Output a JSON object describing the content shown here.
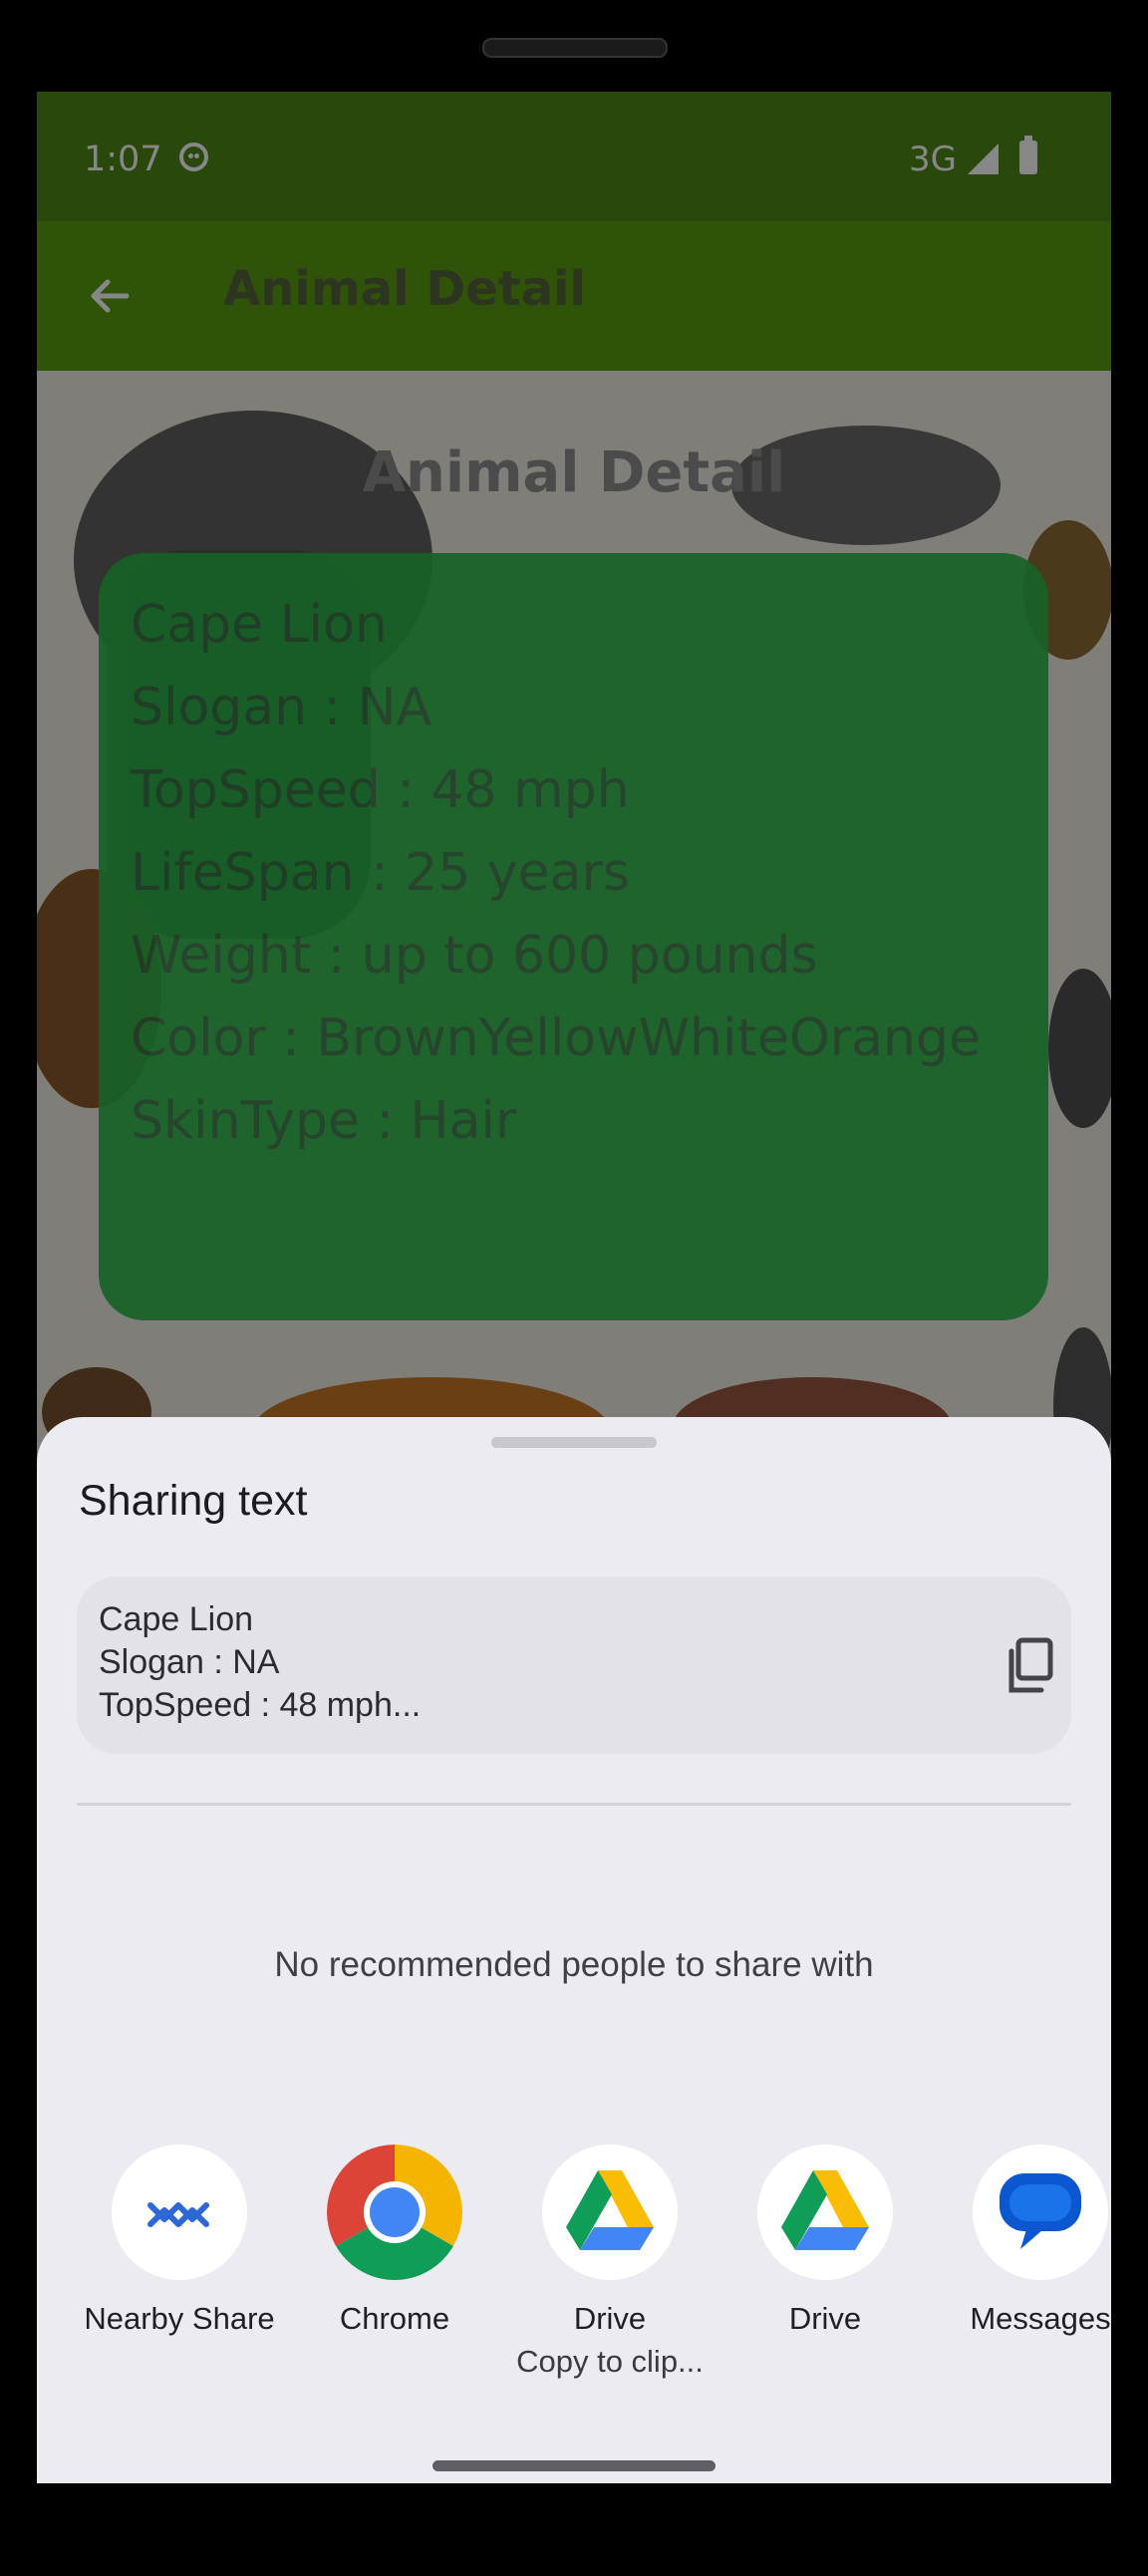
{
  "status_bar": {
    "time": "1:07",
    "network": "3G",
    "status_icon": "face-icon",
    "signal_icon": "signal-icon",
    "battery_icon": "battery-icon"
  },
  "toolbar": {
    "title": "Animal Detail",
    "back_icon": "arrow-back-icon"
  },
  "page": {
    "heading": "Animal Detail"
  },
  "animal": {
    "lines": [
      "Cape Lion",
      "Slogan : NA",
      "TopSpeed : 48 mph",
      "LifeSpan : 25 years",
      "Weight : up to 600 pounds",
      "Color : BrownYellowWhiteOrange",
      "SkinType : Hair"
    ]
  },
  "share_sheet": {
    "title": "Sharing text",
    "preview_lines": [
      "Cape Lion",
      "Slogan : NA",
      "TopSpeed : 48 mph..."
    ],
    "copy_icon": "copy-icon",
    "empty_message": "No recommended people to share with",
    "targets": [
      {
        "label": "Nearby Share",
        "sublabel": "",
        "icon": "nearby-share-icon"
      },
      {
        "label": "Chrome",
        "sublabel": "",
        "icon": "chrome-icon"
      },
      {
        "label": "Drive",
        "sublabel": "Copy to clip...",
        "icon": "drive-icon"
      },
      {
        "label": "Drive",
        "sublabel": "",
        "icon": "drive-icon"
      },
      {
        "label": "Messages",
        "sublabel": "",
        "icon": "messages-icon"
      }
    ]
  },
  "colors": {
    "status_bar": "#4e8917",
    "toolbar": "#5c9d13",
    "detail_card": "#2cb84a",
    "sheet_background": "#ecebf2"
  }
}
